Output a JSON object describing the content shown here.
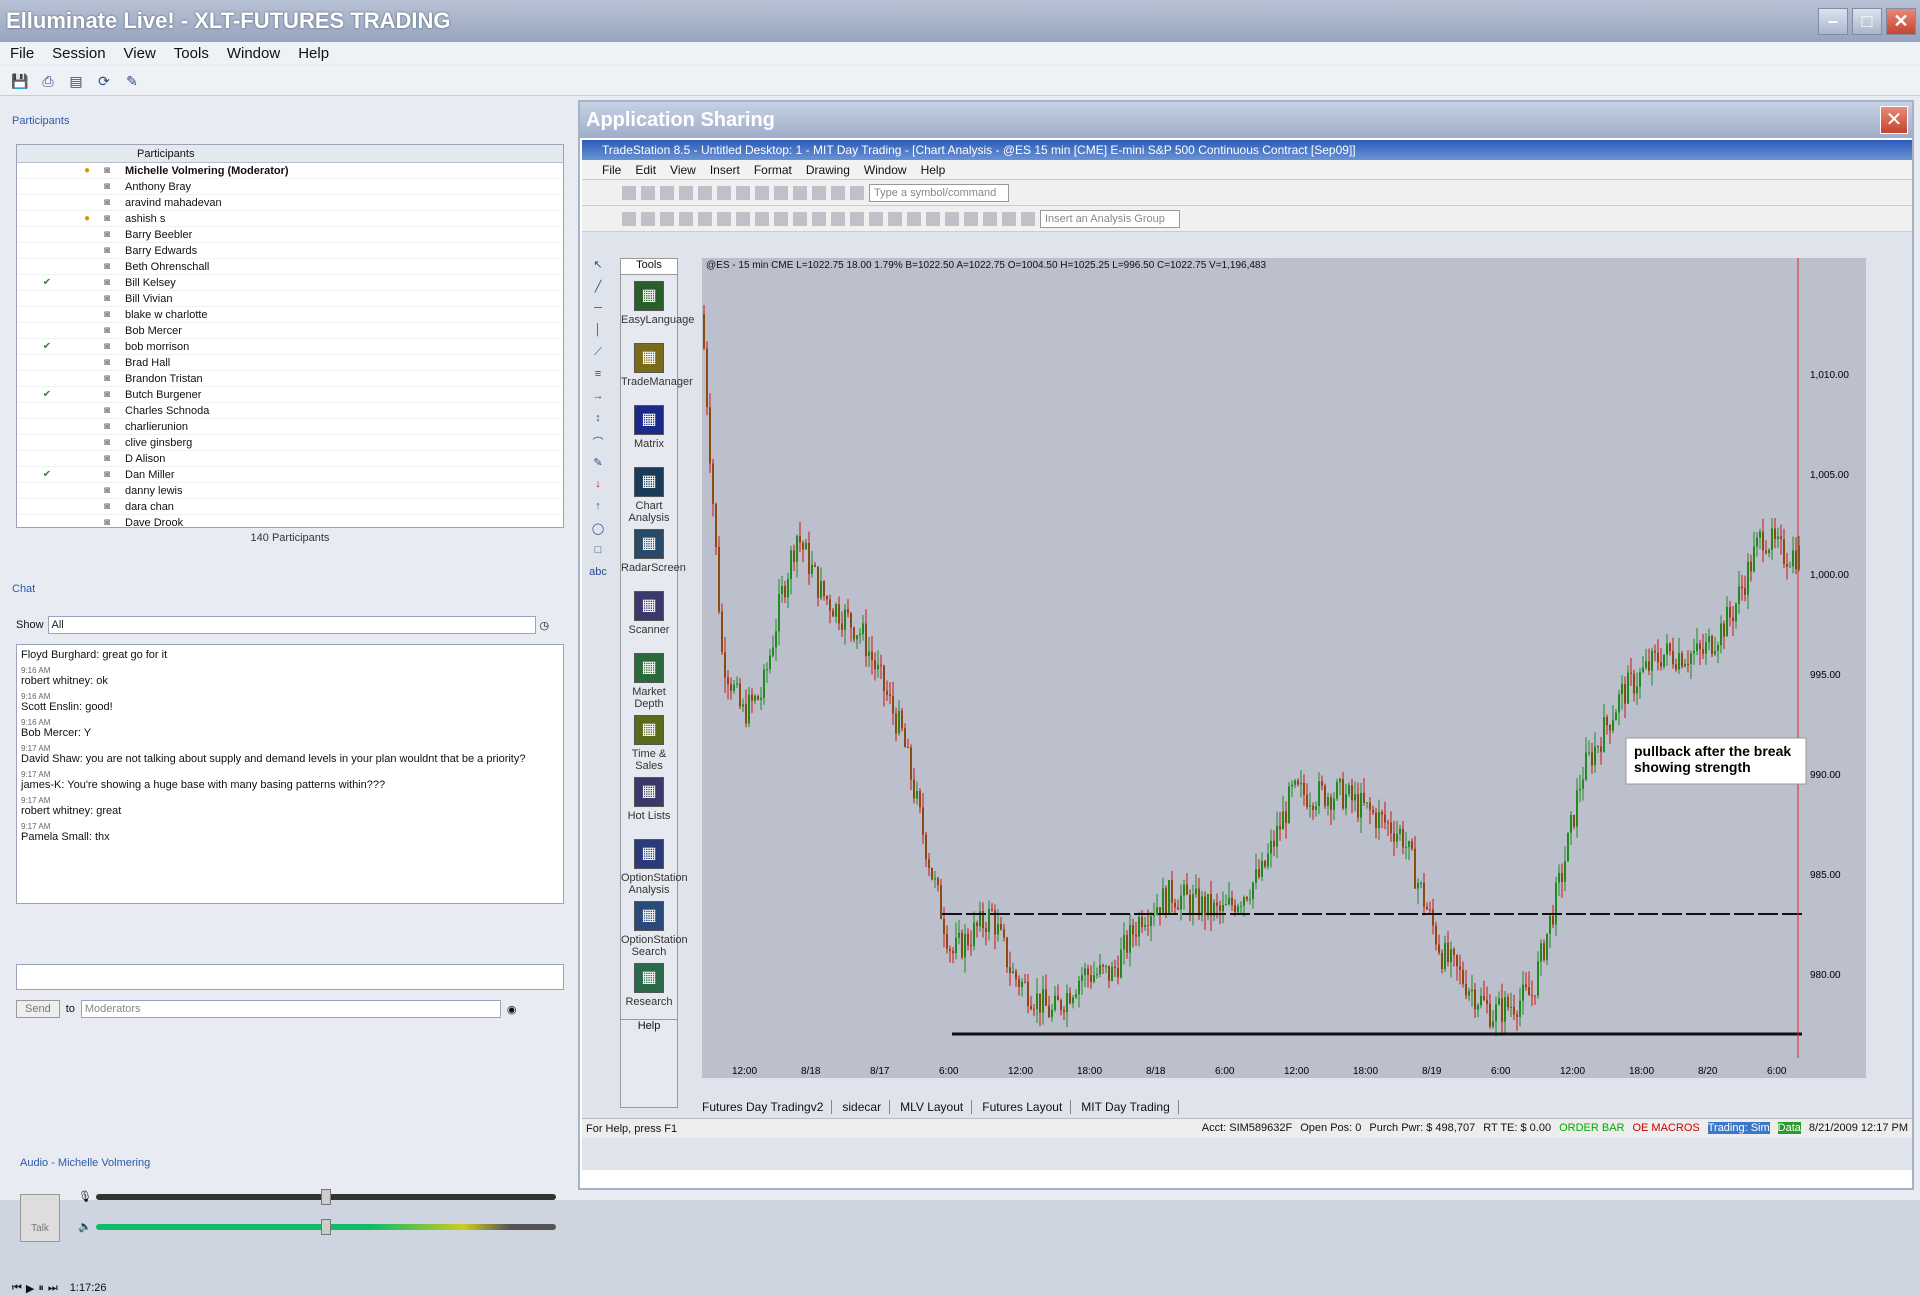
{
  "window": {
    "title": "Elluminate Live! - XLT-FUTURES TRADING"
  },
  "menu": [
    "File",
    "Session",
    "View",
    "Tools",
    "Window",
    "Help"
  ],
  "participants": {
    "header": "Participants",
    "column": "Participants",
    "count": "140 Participants",
    "list": [
      "Michelle Volmering (Moderator)",
      "Anthony Bray",
      "aravind mahadevan",
      "ashish s",
      "Barry Beebler",
      "Barry Edwards",
      "Beth Ohrenschall",
      "Bill Kelsey",
      "Bill Vivian",
      "blake w charlotte",
      "Bob Mercer",
      "bob morrison",
      "Brad Hall",
      "Brandon Tristan",
      "Butch Burgener",
      "Charles Schnoda",
      "charlierunion",
      "clive ginsberg",
      "D Alison",
      "Dan Miller",
      "danny lewis",
      "dara chan",
      "Dave Drook"
    ]
  },
  "chat": {
    "header": "Chat",
    "show_label": "Show",
    "show_value": "All",
    "messages": [
      {
        "time": "",
        "text": "Floyd Burghard: great go for it"
      },
      {
        "time": "9:16 AM",
        "text": "robert whitney: ok"
      },
      {
        "time": "9:16 AM",
        "text": "Scott Enslin: good!"
      },
      {
        "time": "9:16 AM",
        "text": "Bob Mercer: Y"
      },
      {
        "time": "9:17 AM",
        "text": "David Shaw: you are not talking about supply and demand levels in your plan wouldnt that be a priority?"
      },
      {
        "time": "9:17 AM",
        "text": "james-K: You're showing a huge base with many basing patterns within???"
      },
      {
        "time": "9:17 AM",
        "text": "robert whitney: great"
      },
      {
        "time": "9:17 AM",
        "text": "Pamela Small: thx"
      }
    ],
    "send": "Send",
    "to": "to",
    "to_value": "Moderators"
  },
  "audio": {
    "header": "Audio - Michelle Volmering",
    "talk": "Talk",
    "time": "1:17:26"
  },
  "appshare": {
    "title": "Application Sharing"
  },
  "ts": {
    "title": "TradeStation 8.5 - Untitled Desktop: 1 - MIT Day Trading - [Chart Analysis - @ES 15 min [CME] E-mini S&P 500 Continuous Contract [Sep09]]",
    "menu": [
      "File",
      "Edit",
      "View",
      "Insert",
      "Format",
      "Drawing",
      "Window",
      "Help"
    ],
    "symbol_placeholder": "Type a symbol/command",
    "group_placeholder": "Insert an Analysis Group",
    "tools_header": "Tools",
    "tools": [
      "EasyLanguage",
      "TradeManager",
      "Matrix",
      "Chart Analysis",
      "RadarScreen",
      "Scanner",
      "Market Depth",
      "Time & Sales",
      "Hot Lists",
      "OptionStation Analysis",
      "OptionStation Search",
      "Research",
      "EasyLanguage"
    ],
    "help": "Help",
    "tabs": [
      "Futures Day Tradingv2",
      "sidecar",
      "MLV Layout",
      "Futures Layout",
      "MIT Day Trading"
    ],
    "status_left": "For Help, press F1",
    "status": [
      "Acct: SIM589632F",
      "Open Pos: 0",
      "Purch Pwr: $ 498,707",
      "RT TE: $ 0.00",
      "ORDER BAR",
      "OE MACROS",
      "Trading: Sim",
      "Data",
      "8/21/2009 12:17 PM"
    ]
  },
  "chart_data": {
    "type": "candlestick",
    "info": "@ES - 15 min  CME  L=1022.75  18.00  1.79%  B=1022.50  A=1022.75  O=1004.50  H=1025.25  L=996.50  C=1022.75  V=1,196,483",
    "x_ticks": [
      "12:00",
      "8/18",
      "8/17",
      "6:00",
      "12:00",
      "18:00",
      "8/18",
      "6:00",
      "12:00",
      "18:00",
      "8/19",
      "6:00",
      "12:00",
      "18:00",
      "8/20",
      "6:00"
    ],
    "y_ticks": [
      "1,010.00",
      "1,005.00",
      "1,000.00",
      "995.00",
      "990.00",
      "985.00",
      "980.00"
    ],
    "ylim": [
      976,
      1015
    ],
    "annotation": "pullback after the break showing strength",
    "support_lines": [
      983,
      977
    ]
  }
}
